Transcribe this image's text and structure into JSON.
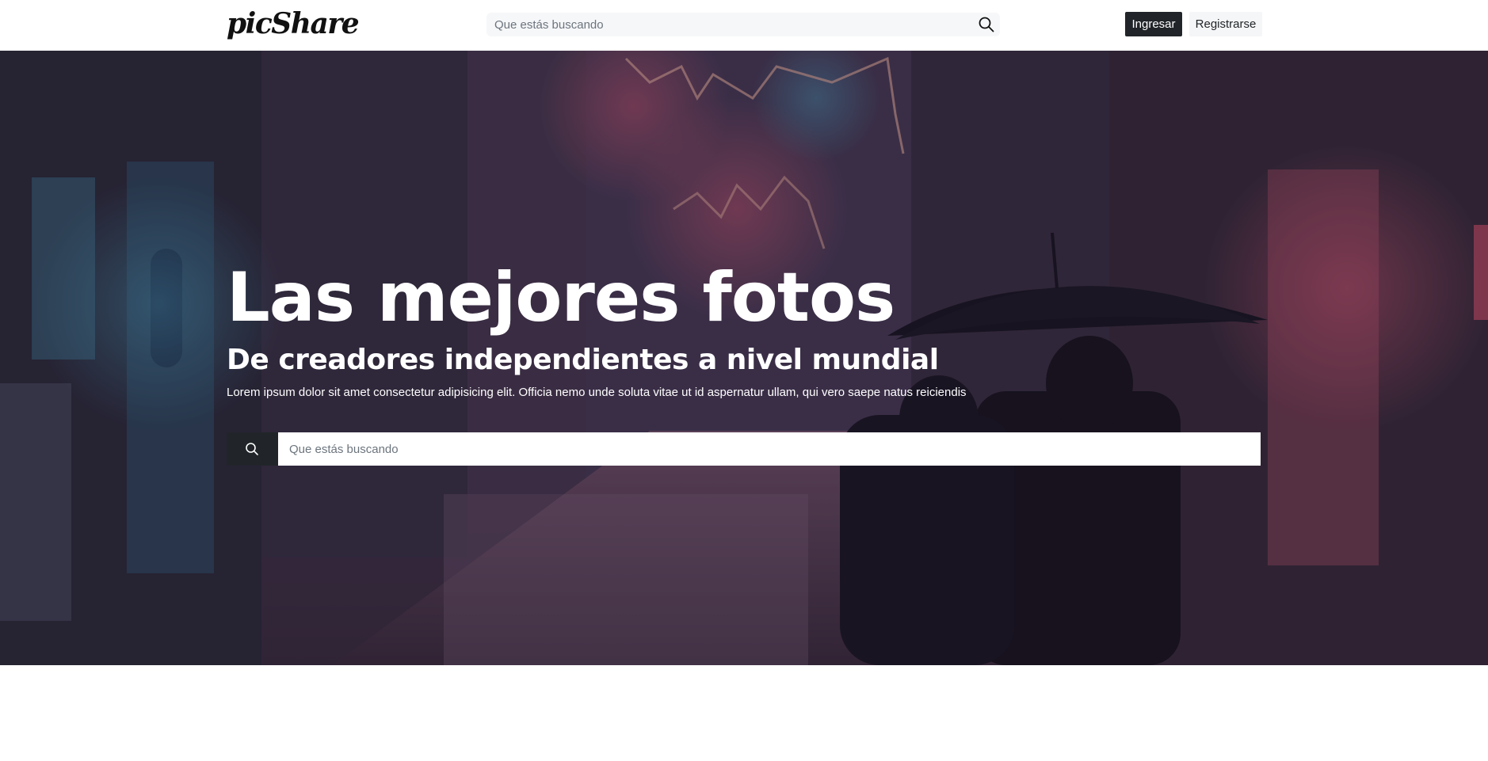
{
  "header": {
    "logo": "picShare",
    "search_placeholder": "Que estás buscando",
    "login_label": "Ingresar",
    "register_label": "Registrarse"
  },
  "hero": {
    "title": "Las mejores fotos",
    "subtitle": "De creadores independientes a nivel mundial",
    "text": "Lorem ipsum dolor sit amet consectetur adipisicing elit. Officia nemo unde soluta vitae ut id aspernatur ullam, qui vero saepe natus reiciendis",
    "search_placeholder": "Que estás buscando"
  },
  "icons": {
    "nav_search": "search-icon",
    "hero_search": "search-icon"
  },
  "colors": {
    "dark_button": "#212529",
    "light_button": "#f5f6f7",
    "hero_tint": "#2a2436"
  }
}
